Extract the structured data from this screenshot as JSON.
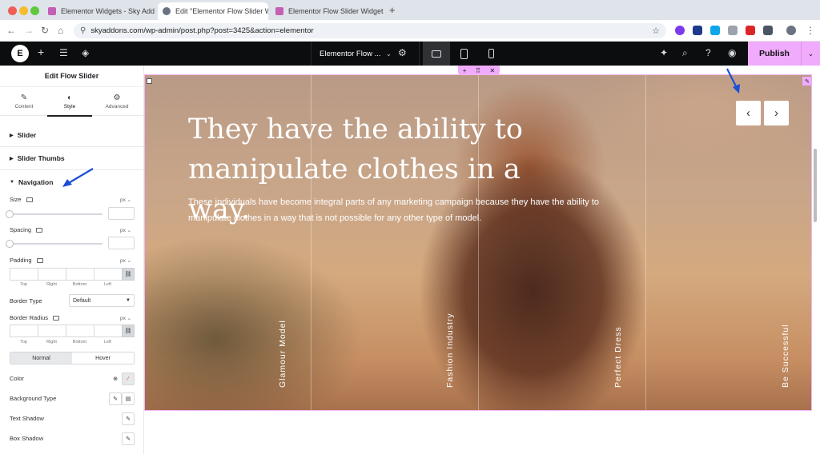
{
  "browser": {
    "tabs": [
      {
        "label": "Elementor Widgets - Sky Add",
        "favicon_color": "#c45fb4"
      },
      {
        "label": "Edit \"Elementor Flow Slider W",
        "favicon_color": "#6b7280"
      },
      {
        "label": "Elementor Flow Slider Widget",
        "favicon_color": "#c45fb4"
      }
    ],
    "close_glyph": "✕",
    "new_tab": "+",
    "url": "skyaddons.com/wp-admin/post.php?post=3425&action=elementor",
    "back": "←",
    "forward": "→",
    "reload": "↻",
    "home": "⌂"
  },
  "editor": {
    "logo": "E",
    "document_title": "Elementor Flow ...",
    "publish_label": "Publish",
    "add_glyph": "+",
    "settings_glyph": "⚙",
    "search_glyph": "⌕",
    "help_glyph": "?",
    "preview_glyph": "◉",
    "notes_glyph": "✦"
  },
  "panel": {
    "title": "Edit Flow Slider",
    "tabs": [
      {
        "label": "Content",
        "icon": "✎"
      },
      {
        "label": "Style",
        "icon": "◐"
      },
      {
        "label": "Advanced",
        "icon": "⚙"
      }
    ],
    "sections": {
      "slider": "Slider",
      "slider_thumbs": "Slider Thumbs",
      "navigation": "Navigation"
    },
    "controls": {
      "size_label": "Size",
      "spacing_label": "Spacing",
      "padding_label": "Padding",
      "border_type_label": "Border Type",
      "border_type_value": "Default",
      "border_radius_label": "Border Radius",
      "unit": "px ⌄",
      "dim_top": "Top",
      "dim_right": "Right",
      "dim_bottom": "Bottom",
      "dim_left": "Left",
      "normal_label": "Normal",
      "hover_label": "Hover",
      "color_label": "Color",
      "background_type_label": "Background Type",
      "text_shadow_label": "Text Shadow",
      "box_shadow_label": "Box Shadow"
    }
  },
  "slider": {
    "title": "They have the ability to manipulate clothes in a way.",
    "text": "These individuals have become integral parts of any marketing campaign because they have the ability to manipulate clothes in a way that is not possible for any other type of model.",
    "thumbs": [
      "Glamour Model",
      "Fashion Industry",
      "Perfect Dress",
      "Be Successful"
    ],
    "prev_glyph": "‹",
    "next_glyph": "›"
  },
  "colors": {
    "accent": "#f0abfc",
    "annotation_arrow": "#1d4ed8",
    "topbar": "#0c0d0e"
  }
}
